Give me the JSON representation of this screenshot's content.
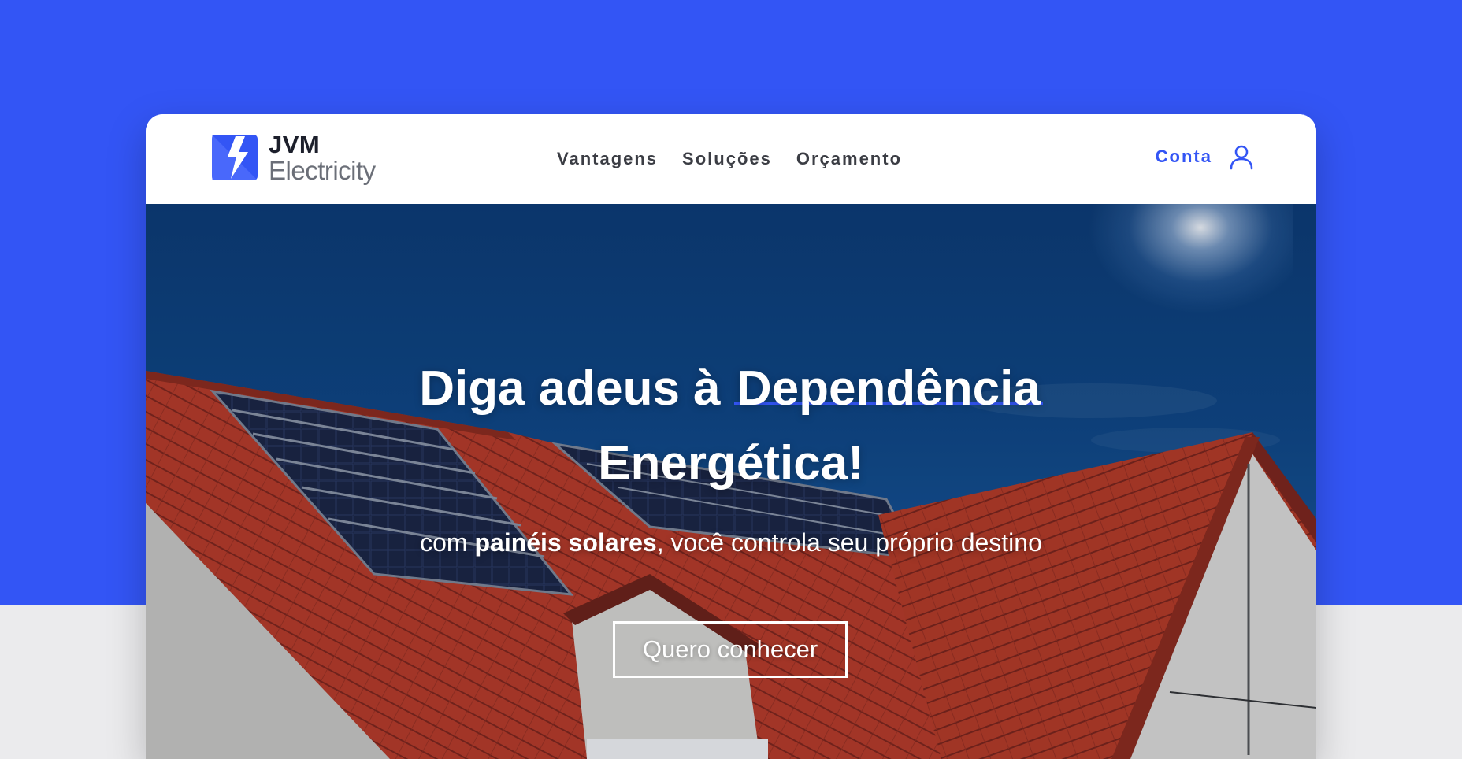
{
  "brand": {
    "name_line1": "JVM",
    "name_line2": "Electricity",
    "logo_color": "#3355f5"
  },
  "nav": {
    "items": [
      {
        "label": "Vantagens"
      },
      {
        "label": "Soluções"
      },
      {
        "label": "Orçamento"
      }
    ]
  },
  "account": {
    "label": "Conta",
    "icon": "user-icon"
  },
  "hero": {
    "title_part1": "Diga adeus à ",
    "title_highlight": "Dependência",
    "title_part2": "Energética!",
    "subtitle_prefix": "com ",
    "subtitle_bold": "painéis solares",
    "subtitle_suffix": ", você controla seu próprio destino",
    "cta_label": "Quero conhecer"
  },
  "colors": {
    "accent": "#3355f5",
    "background_top": "#3355f5",
    "background_bottom": "#ebebed",
    "sky": "#0e4582",
    "roof": "#b83a25"
  }
}
